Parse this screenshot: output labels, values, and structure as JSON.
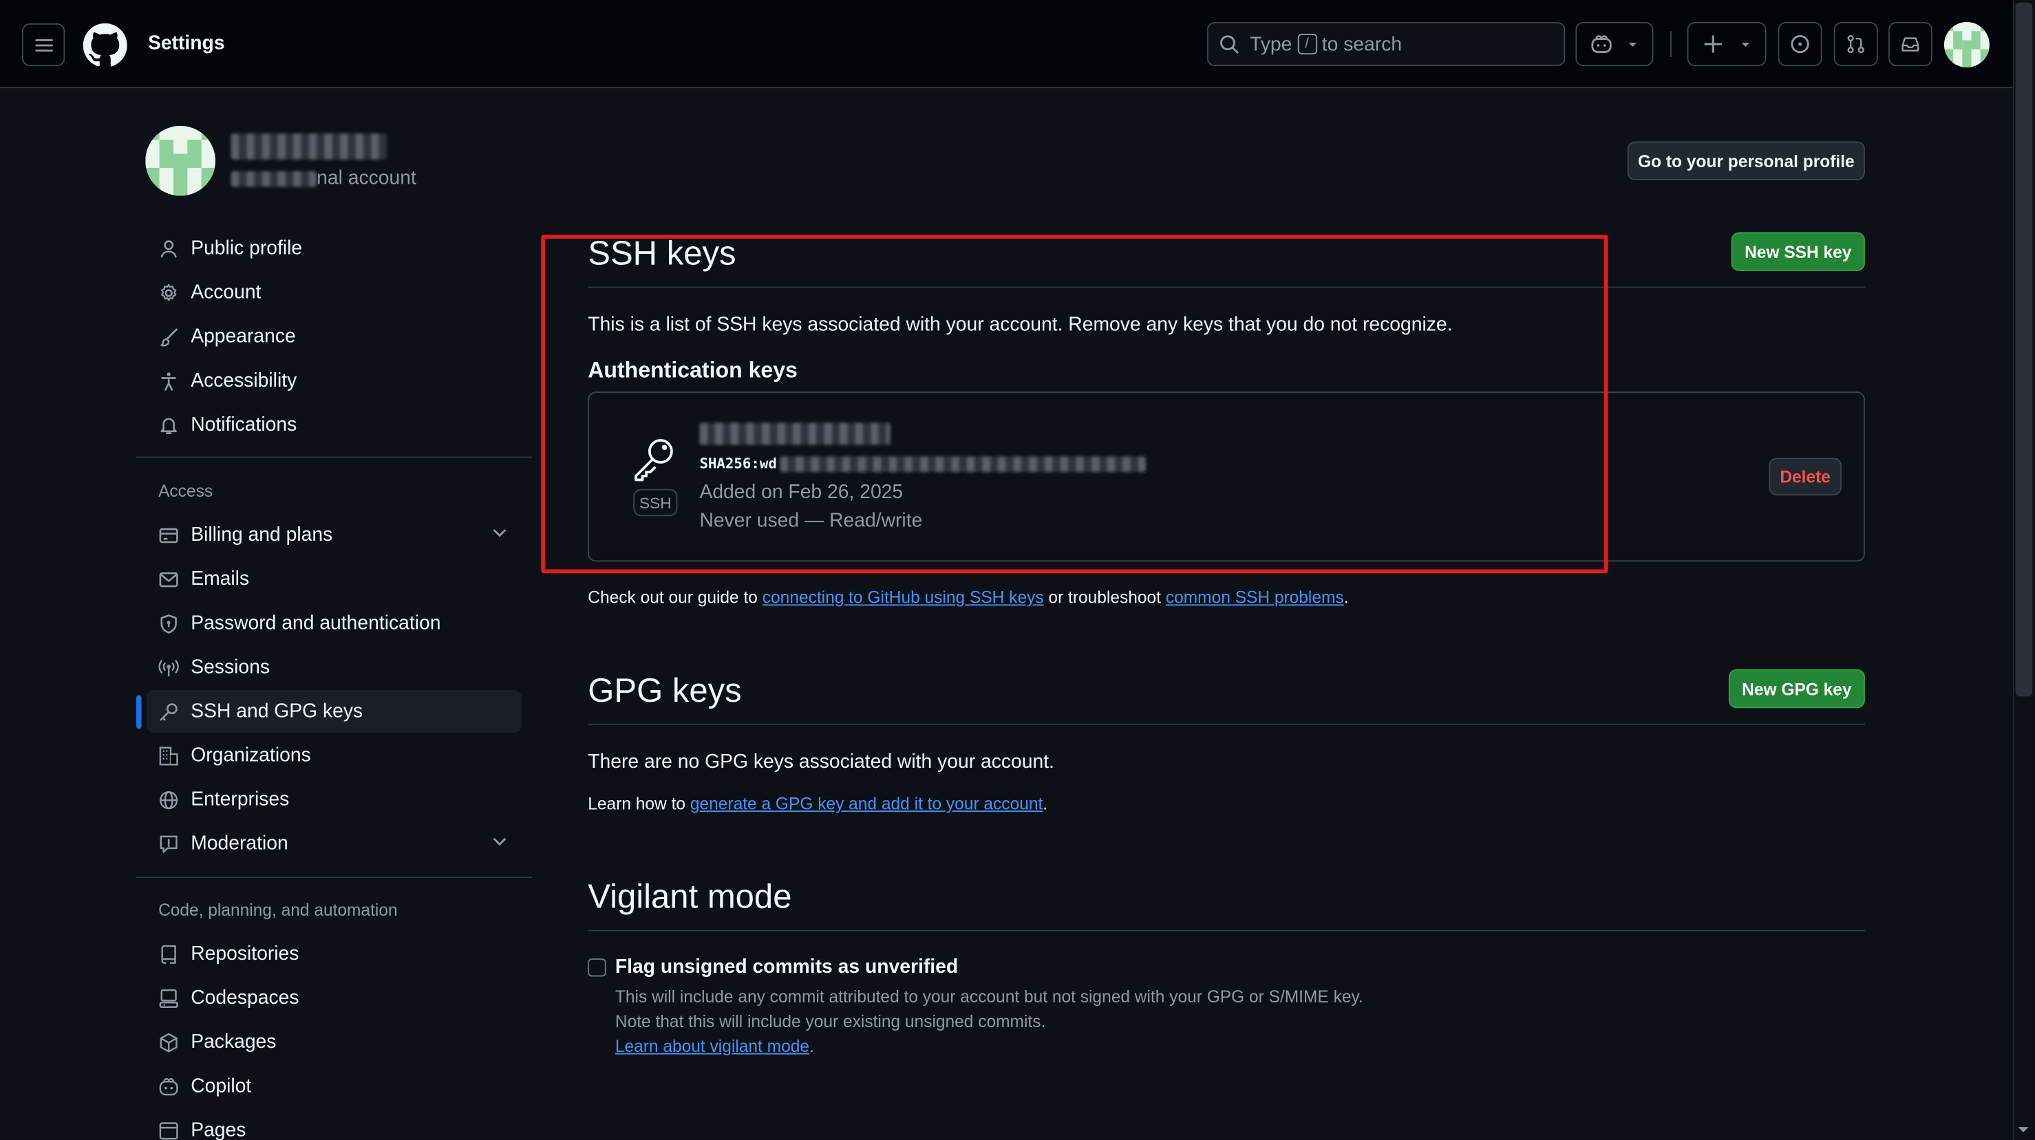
{
  "header": {
    "title": "Settings",
    "search_prefix": "Type",
    "search_key": "/",
    "search_suffix": "to search"
  },
  "profile": {
    "subtitle": "nal account",
    "go_profile_button": "Go to your personal profile"
  },
  "sidebar": {
    "items": [
      {
        "label": "Public profile",
        "icon": "person-icon"
      },
      {
        "label": "Account",
        "icon": "gear-icon"
      },
      {
        "label": "Appearance",
        "icon": "paintbrush-icon"
      },
      {
        "label": "Accessibility",
        "icon": "accessibility-icon"
      },
      {
        "label": "Notifications",
        "icon": "bell-icon"
      }
    ],
    "access_heading": "Access",
    "access_items": [
      {
        "label": "Billing and plans",
        "icon": "credit-card-icon"
      },
      {
        "label": "Emails",
        "icon": "mail-icon"
      },
      {
        "label": "Password and authentication",
        "icon": "shield-lock-icon"
      },
      {
        "label": "Sessions",
        "icon": "broadcast-icon"
      },
      {
        "label": "SSH and GPG keys",
        "icon": "key-icon"
      },
      {
        "label": "Organizations",
        "icon": "organization-icon"
      },
      {
        "label": "Enterprises",
        "icon": "globe-icon"
      },
      {
        "label": "Moderation",
        "icon": "report-icon"
      }
    ],
    "code_heading": "Code, planning, and automation",
    "code_items": [
      {
        "label": "Repositories",
        "icon": "repo-icon"
      },
      {
        "label": "Codespaces",
        "icon": "codespaces-icon"
      },
      {
        "label": "Packages",
        "icon": "package-icon"
      },
      {
        "label": "Copilot",
        "icon": "copilot-icon"
      },
      {
        "label": "Pages",
        "icon": "browser-icon"
      }
    ]
  },
  "ssh": {
    "title": "SSH keys",
    "new_button": "New SSH key",
    "description": "This is a list of SSH keys associated with your account. Remove any keys that you do not recognize.",
    "auth_heading": "Authentication keys",
    "key": {
      "badge": "SSH",
      "fingerprint_prefix": "SHA256:wd",
      "added": "Added on Feb 26, 2025",
      "usage": "Never used — Read/write",
      "delete_button": "Delete"
    },
    "guide_prefix": "Check out our guide to",
    "guide_link": "connecting to GitHub using SSH keys",
    "guide_middle": "or troubleshoot",
    "guide_link2": "common SSH problems",
    "guide_end": "."
  },
  "gpg": {
    "title": "GPG keys",
    "new_button": "New GPG key",
    "empty": "There are no GPG keys associated with your account.",
    "learn_prefix": "Learn how to",
    "learn_link": "generate a GPG key and add it to your account",
    "learn_end": "."
  },
  "vigilant": {
    "title": "Vigilant mode",
    "checkbox_label": "Flag unsigned commits as unverified",
    "checked": false,
    "desc1": "This will include any commit attributed to your account but not signed with your GPG or S/MIME key.",
    "desc2": "Note that this will include your existing unsigned commits.",
    "learn_link": "Learn about vigilant mode",
    "learn_end": "."
  },
  "colors": {
    "background": "#0d1117",
    "header": "#010409",
    "green": "#238636",
    "link": "#4493f8",
    "danger": "#f85149",
    "highlight_box": "#e11d1d",
    "active_bar": "#1f6feb"
  }
}
